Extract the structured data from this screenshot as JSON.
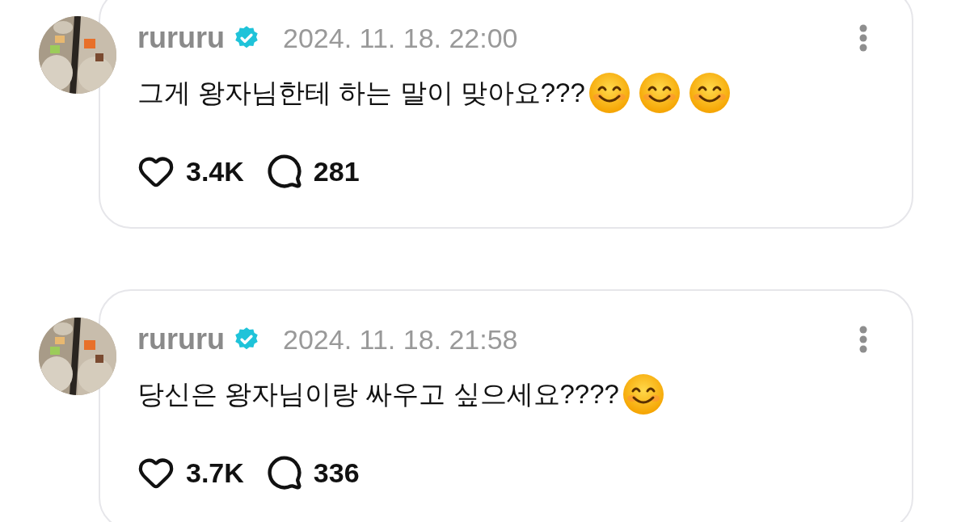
{
  "posts": [
    {
      "author": "rururu",
      "verified": true,
      "date": "2024. 11. 18. 22:00",
      "text": "그게 왕자님한테 하는 말이 맞아요???",
      "emojis": [
        {
          "kind": "smiling"
        },
        {
          "kind": "smiling"
        },
        {
          "kind": "smiling"
        }
      ],
      "likes": "3.4K",
      "replies": "281"
    },
    {
      "author": "rururu",
      "verified": true,
      "date": "2024. 11. 18. 21:58",
      "text": "당신은 왕자님이랑 싸우고 싶으세요????",
      "emojis": [
        {
          "kind": "smiling"
        }
      ],
      "likes": "3.7K",
      "replies": "336"
    }
  ]
}
